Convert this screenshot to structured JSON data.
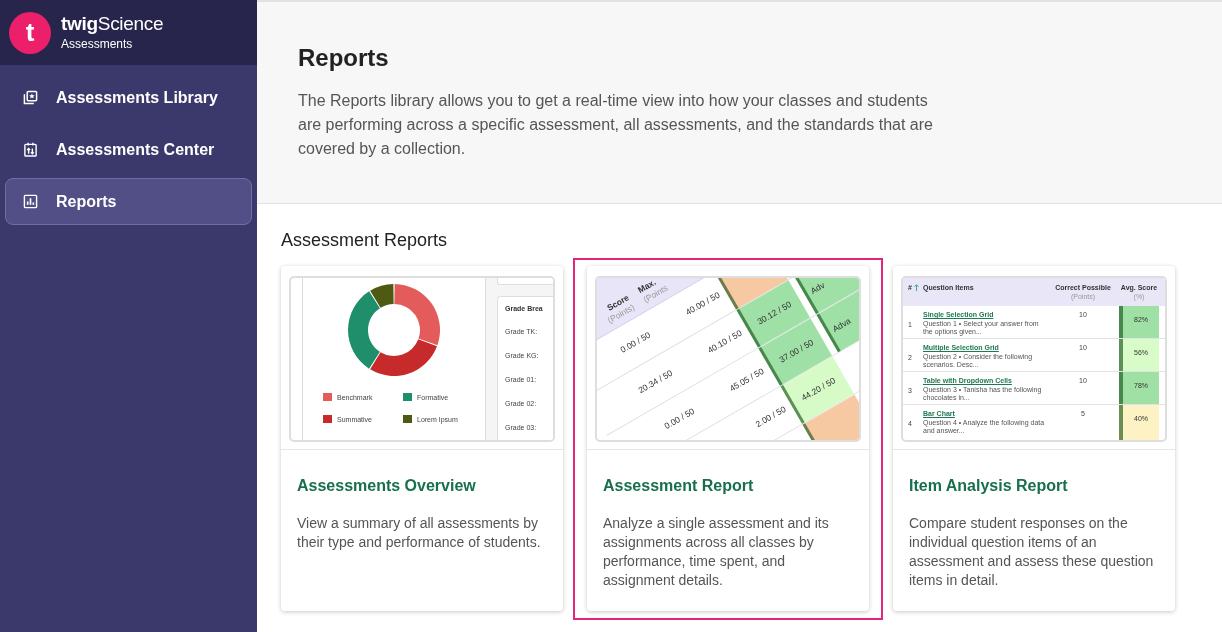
{
  "sidebar": {
    "logo": {
      "letter": "t",
      "brand": "**twig**Science",
      "product": "Assessments"
    },
    "items": [
      {
        "label": "Assessments Library",
        "selected": false
      },
      {
        "label": "Assessments Center",
        "selected": false
      },
      {
        "label": "Reports",
        "selected": true
      }
    ]
  },
  "header": {
    "title": "Reports",
    "description": "The Reports library allows you to get a real-time view into how your classes and students are performing across a specific assessment, all assessments, and the standards that are covered by a collection."
  },
  "section": {
    "title": "Assessment Reports",
    "cards": [
      {
        "title": "Assessments Overview",
        "description": "View a summary of all assessments by their type and performance of students.",
        "selected": false,
        "preview": {
          "kind": "donut",
          "legend": [
            {
              "label": "Benchmark",
              "color": "#e35b5b"
            },
            {
              "label": "Formative",
              "color": "#1f8f6b"
            },
            {
              "label": "Summative",
              "color": "#c62a2a"
            },
            {
              "label": "Lorem Ipsum",
              "color": "#4e5a12"
            }
          ],
          "panel_title": "Grade Brea",
          "panel_rows": [
            "Grade TK:",
            "Grade KG:",
            "Grade 01:",
            "Grade 02:",
            "Grade 03:"
          ]
        }
      },
      {
        "title": "Assessment Report",
        "description": "Analyze a single assessment and its assignments across all classes by performance, time spent, and assignment details.",
        "selected": true,
        "preview": {
          "kind": "rotated_table",
          "columns": [
            {
              "label": "Score",
              "unit": "(Points)"
            },
            {
              "label": "Max.",
              "unit": "(Points"
            }
          ],
          "rows": [
            {
              "score": "0.00 / 50",
              "max": "40.00 / 50",
              "column_3": {
                "color": "#f6c9a3"
              }
            },
            {
              "score": "20.34 / 50",
              "max": "40.10 / 50",
              "column_3": {
                "text": "30.12 / 50",
                "color": "#9fe0a7"
              },
              "column_4": {
                "text": "Adv",
                "color": "#9fe0a7"
              }
            },
            {
              "score": "0.00 / 50",
              "max": "45.05 / 50",
              "column_3": {
                "text": "37.00 / 50",
                "color": "#9fe0a7"
              },
              "column_4": {
                "text": "Adva",
                "color": "#9fe0a7"
              }
            },
            {
              "max": "2.00 / 50",
              "column_3": {
                "text": "44.20 / 50",
                "color": "#d6fbc6"
              }
            },
            {
              "column_3": {
                "color": "#f6c9a3"
              }
            }
          ]
        }
      },
      {
        "title": "Item Analysis Report",
        "description": "Compare student responses on the individual question items of an assessment and assess these question items in detail.",
        "selected": false,
        "preview": {
          "kind": "table",
          "columns": [
            {
              "label": "#"
            },
            {
              "label": "Question Items"
            },
            {
              "label": "Correct Possible",
              "unit": "(Points)"
            },
            {
              "label": "Avg. Score",
              "unit": "(%)"
            }
          ],
          "rows": [
            {
              "number": "1",
              "title": "Single Selection Grid",
              "subtitle": "Question 1 • Select your answer from the options given...",
              "points": "10",
              "score": "82%",
              "color": "#9fe0a5"
            },
            {
              "number": "2",
              "title": "Multiple Selection Grid",
              "subtitle": "Question 2 • Consider the following scenarios. Desc...",
              "points": "10",
              "score": "56%",
              "color": "#d8fcc8"
            },
            {
              "number": "3",
              "title": "Table with Dropdown Cells",
              "subtitle": "Question 3 • Tanisha has the following chocolates in...",
              "points": "10",
              "score": "78%",
              "color": "#9fe0a5"
            },
            {
              "number": "4",
              "title": "Bar Chart",
              "subtitle": "Question 4 • Analyze the following data and answer...",
              "points": "5",
              "score": "40%",
              "color": "#fdf2c4"
            }
          ]
        }
      }
    ]
  }
}
